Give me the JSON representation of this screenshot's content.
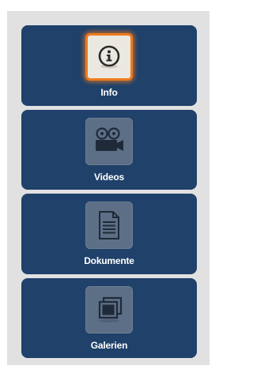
{
  "nav": {
    "items": [
      {
        "label": "Info",
        "icon": "info-icon",
        "active": true
      },
      {
        "label": "Videos",
        "icon": "video-camera-icon",
        "active": false
      },
      {
        "label": "Dokumente",
        "icon": "document-icon",
        "active": false
      },
      {
        "label": "Galerien",
        "icon": "gallery-icon",
        "active": false
      }
    ]
  },
  "colors": {
    "panel_bg": "#e1e1e1",
    "item_bg": "#1f416a",
    "active_highlight": "#ef7a1d",
    "inactive_tile": "#5d6f86"
  }
}
